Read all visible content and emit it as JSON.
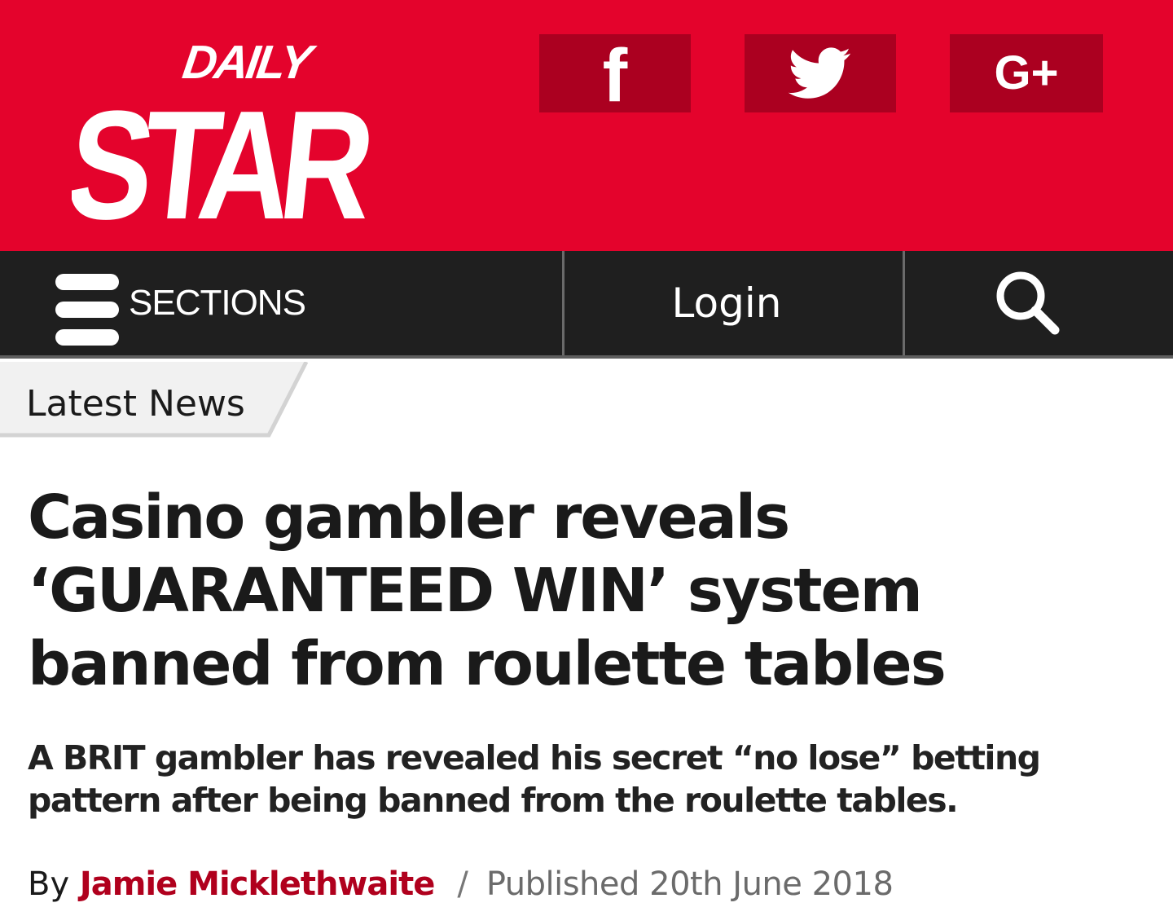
{
  "brand": {
    "name": "DAILY STAR",
    "logo_top": "DAILY",
    "logo_main": "STAR",
    "header_color": "#e4032c",
    "social_button_color": "#ab0020",
    "nav_color": "#1f1f1f",
    "author_color": "#b0001d"
  },
  "social": [
    {
      "name": "facebook",
      "glyph": "f",
      "icon": "facebook-icon"
    },
    {
      "name": "twitter",
      "icon": "twitter-bird-icon"
    },
    {
      "name": "google-plus",
      "glyph": "G+",
      "icon": "google-plus-icon"
    }
  ],
  "nav": {
    "sections_label": "SECTIONS",
    "sections_icon": "hamburger-menu-icon",
    "login_label": "Login",
    "search_icon": "search-icon"
  },
  "breadcrumb": {
    "label": "Latest News"
  },
  "article": {
    "headline": "Casino gambler reveals ‘GUARANTEED WIN’ system banned from roulette tables",
    "standfirst": "A BRIT gambler has revealed his secret “no lose” betting pattern after being banned from the roulette tables.",
    "byline_prefix": "By",
    "author": "Jamie Micklethwaite",
    "separator": "/",
    "published": "Published 20th June 2018"
  }
}
